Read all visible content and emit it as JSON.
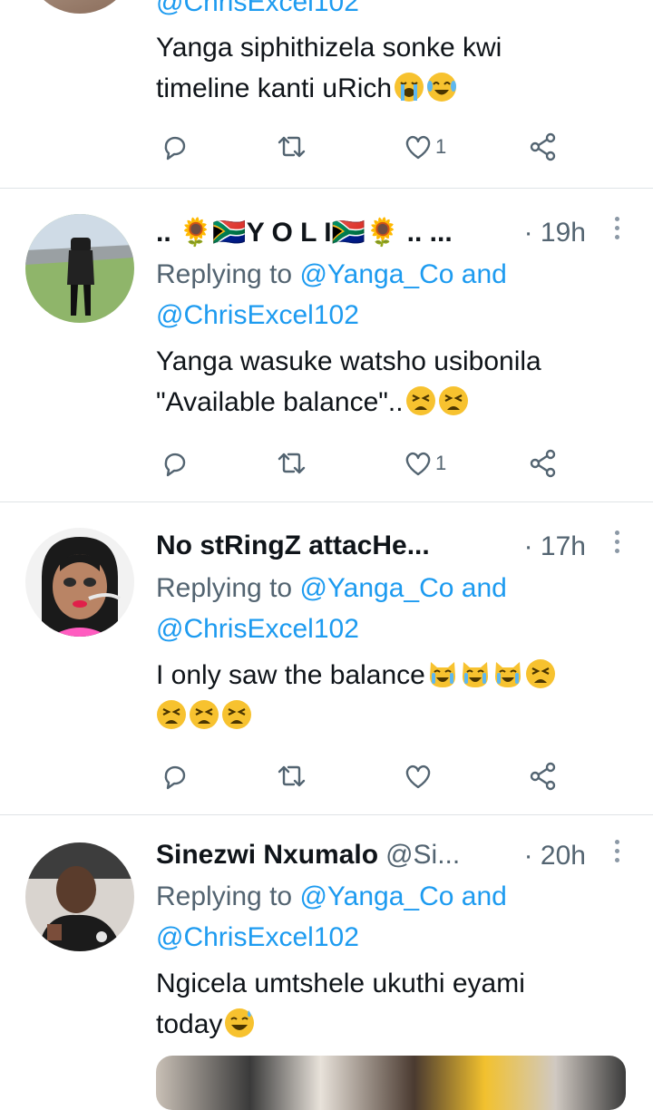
{
  "tweets": [
    {
      "handle": "@ChrisExcel102",
      "text": "Yanga siphithizela sonke kwi timeline kanti uRich",
      "emojis": [
        "loudly-crying-face",
        "face-with-tears-of-joy"
      ],
      "likes": "1"
    },
    {
      "name": ".. 🌻🇿🇦Y O L I🇿🇦🌻 .. ...",
      "time": "· 19h",
      "reply_prefix": "Replying to",
      "mention1": "@Yanga_Co",
      "and": "and",
      "mention2": "@ChrisExcel102",
      "text_line1": "Yanga wasuke watsho usibonila",
      "text_line2": "\"Available balance\"..",
      "emojis": [
        "tired-face",
        "tired-face"
      ],
      "likes": "1"
    },
    {
      "name": "No stRingZ attacHe...",
      "time": "· 17h",
      "reply_prefix": "Replying to",
      "mention1": "@Yanga_Co",
      "and": "and",
      "mention2": "@ChrisExcel102",
      "text": "I only saw the balance",
      "emojis": [
        "crying-cat",
        "crying-cat",
        "crying-cat",
        "tired-face",
        "tired-face",
        "tired-face",
        "tired-face"
      ],
      "likes": ""
    },
    {
      "name": "Sinezwi Nxumalo",
      "handle": "@Si...",
      "time": "· 20h",
      "reply_prefix": "Replying to",
      "mention1": "@Yanga_Co",
      "and": "and",
      "mention2": "@ChrisExcel102",
      "text_line1": "Ngicela umtshele ukuthi eyami",
      "text_line2": "today",
      "emojis": [
        "grinning-sweat-face"
      ]
    }
  ],
  "colors": {
    "mention": "#1d9bf0",
    "muted": "#536471",
    "emoji": "#f7c22f"
  }
}
